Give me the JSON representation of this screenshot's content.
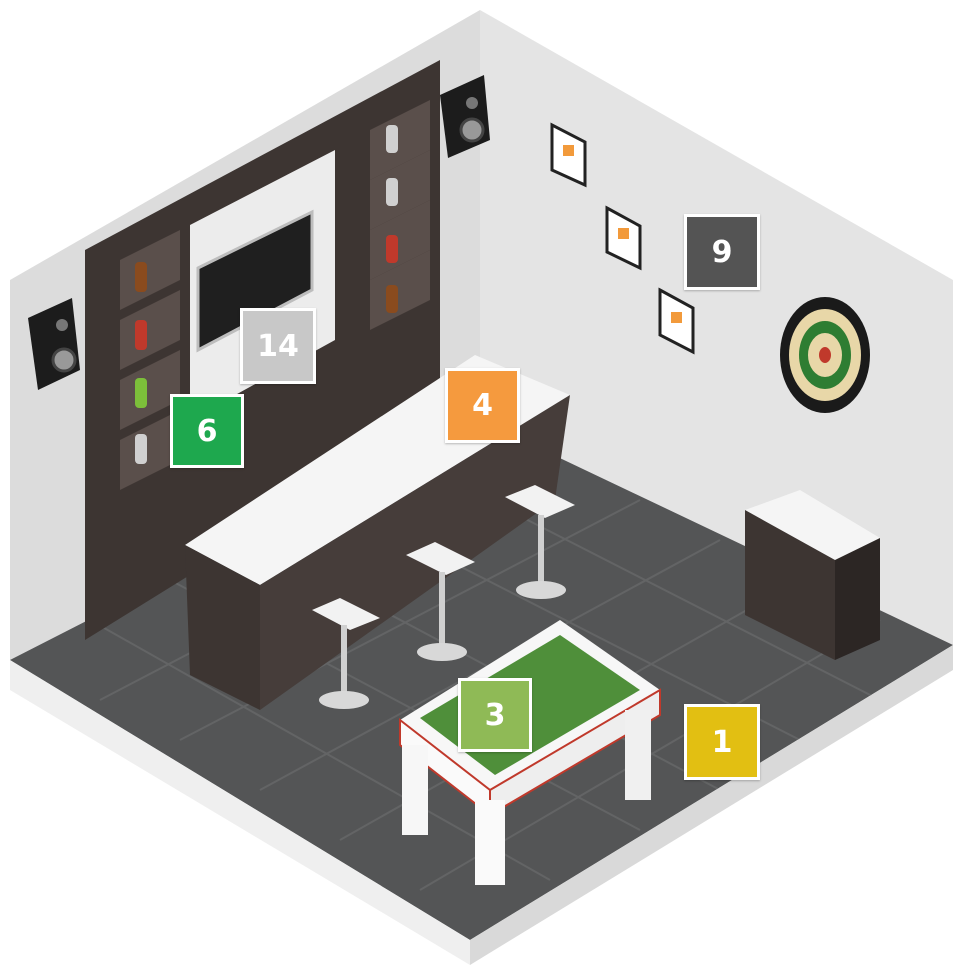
{
  "badges": [
    {
      "key": "badge-14",
      "label": "14",
      "color": "#c8c8c8"
    },
    {
      "key": "badge-6",
      "label": "6",
      "color": "#1ea84e"
    },
    {
      "key": "badge-4",
      "label": "4",
      "color": "#f59a3e"
    },
    {
      "key": "badge-9",
      "label": "9",
      "color": "#545454"
    },
    {
      "key": "badge-3",
      "label": "3",
      "color": "#8fba56"
    },
    {
      "key": "badge-1",
      "label": "1",
      "color": "#e2bf12"
    }
  ],
  "colors": {
    "wall": "#d7d7d7",
    "wall_back": "#e3e3e3",
    "floor": "#555657",
    "cabinet": "#3f3633",
    "counter": "#f5f5f5",
    "accent_orange": "#f29a3b",
    "accent_red": "#c0392b"
  },
  "icons": [
    "speaker-left-icon",
    "speaker-right-icon",
    "tv-icon",
    "dartboard-icon",
    "foosball-table-icon",
    "bar-stool-icon",
    "picture-frame-icon",
    "bottle-icon"
  ]
}
